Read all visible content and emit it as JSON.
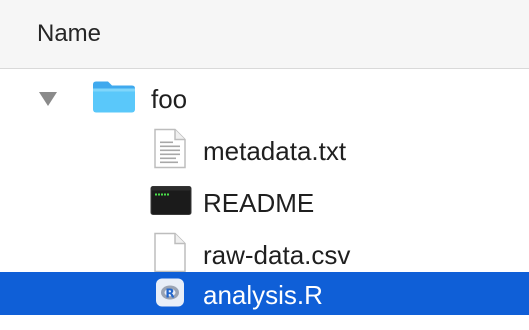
{
  "header": {
    "column_label": "Name"
  },
  "colors": {
    "selection": "#0f5fd7",
    "folder": "#5ac8fa"
  },
  "rows": [
    {
      "name": "foo",
      "icon": "folder-icon",
      "expanded": true,
      "selected": false
    },
    {
      "name": "metadata.txt",
      "icon": "text-document-icon",
      "selected": false
    },
    {
      "name": "README",
      "icon": "terminal-executable-icon",
      "selected": false
    },
    {
      "name": "raw-data.csv",
      "icon": "blank-document-icon",
      "selected": false
    },
    {
      "name": "analysis.R",
      "icon": "r-script-icon",
      "selected": true
    }
  ]
}
